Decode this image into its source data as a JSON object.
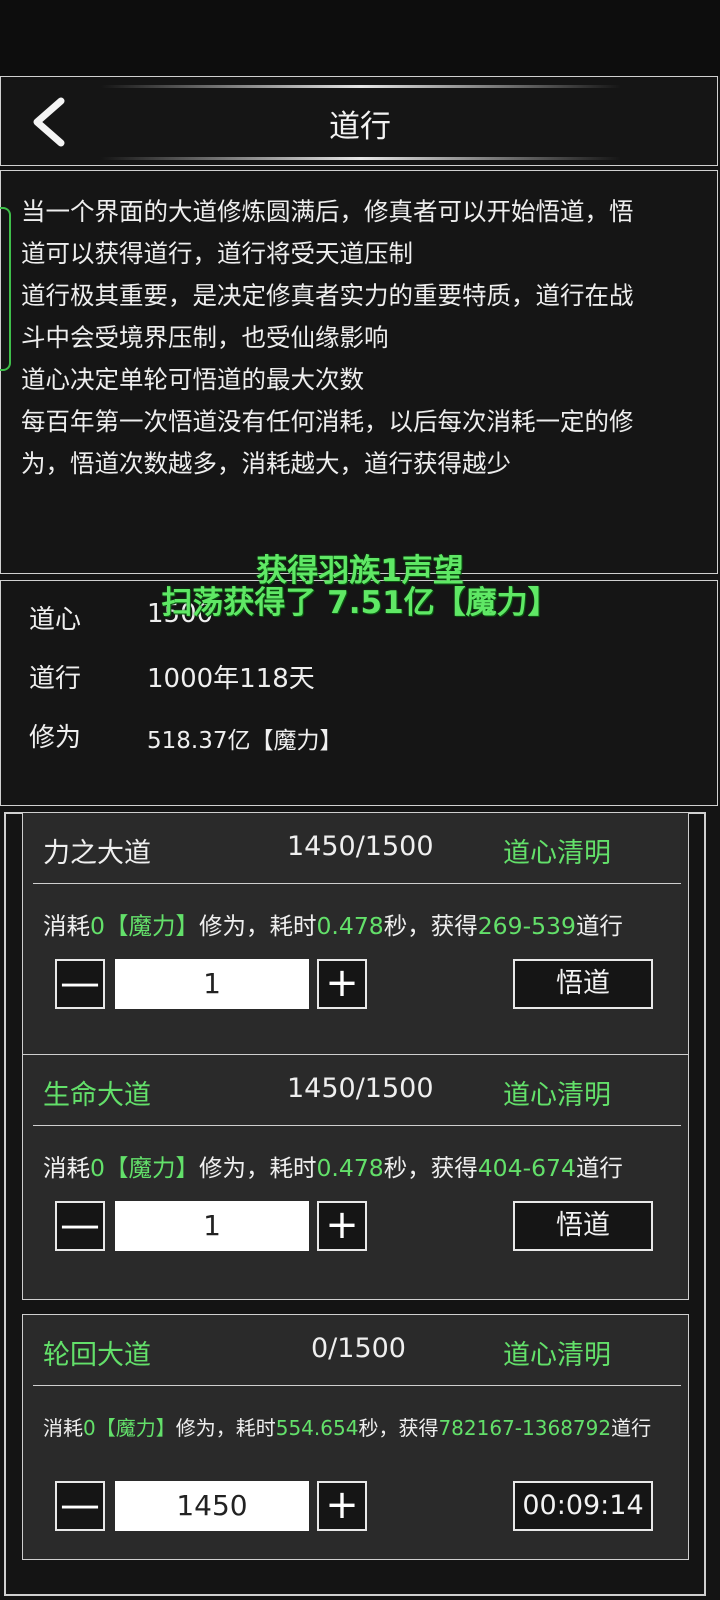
{
  "header": {
    "title": "道行",
    "back_icon": "chevron-left-icon"
  },
  "description": {
    "lines": [
      "当一个界面的大道修炼圆满后，修真者可以开始悟道，悟",
      "道可以获得道行，道行将受天道压制",
      "道行极其重要，是决定修真者实力的重要特质，道行在战",
      "斗中会受境界压制，也受仙缘影响",
      "道心决定单轮可悟道的最大次数",
      "每百年第一次悟道没有任何消耗，以后每次消耗一定的修",
      "为，悟道次数越多，消耗越大，道行获得越少"
    ]
  },
  "toasts": [
    "获得羽族1声望",
    "扫荡获得了 7.51亿【魔力】"
  ],
  "stats": {
    "daoxin": {
      "label": "道心",
      "value": "1500"
    },
    "daoxing": {
      "label": "道行",
      "value": "1000年118天"
    },
    "xiuwei": {
      "label": "修为",
      "value": "518.37亿【魔力】"
    }
  },
  "colors": {
    "accent_green": "#63e06a",
    "panel_bg": "#2a2a2a",
    "page_bg": "#141414"
  },
  "paths": [
    {
      "name": "力之大道",
      "progress": "1450/1500",
      "state": "道心清明",
      "cost": {
        "p1": "消耗",
        "cost_value": "0【魔力】",
        "p2": "修为，耗时",
        "time": "0.478",
        "p3": "秒，获得",
        "gain": "269-539",
        "p4": "道行"
      },
      "minus": "—",
      "quantity": "1",
      "plus": "+",
      "action": "悟道"
    },
    {
      "name": "生命大道",
      "progress": "1450/1500",
      "state": "道心清明",
      "cost": {
        "p1": "消耗",
        "cost_value": "0【魔力】",
        "p2": "修为，耗时",
        "time": "0.478",
        "p3": "秒，获得",
        "gain": "404-674",
        "p4": "道行"
      },
      "minus": "—",
      "quantity": "1",
      "plus": "+",
      "action": "悟道"
    },
    {
      "name": "轮回大道",
      "progress": "0/1500",
      "state": "道心清明",
      "cost": {
        "p1": "消耗",
        "cost_value": "0【魔力】",
        "p2": "修为，耗时",
        "time": "554.654",
        "p3": "秒，获得",
        "gain": "782167-1368792",
        "p4": "道行"
      },
      "minus": "—",
      "quantity": "1450",
      "plus": "+",
      "action": "00:09:14"
    }
  ]
}
